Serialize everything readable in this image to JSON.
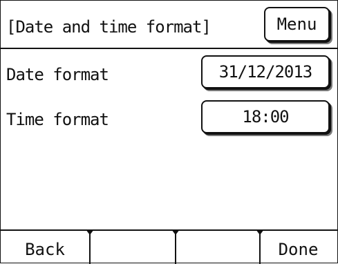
{
  "header": {
    "title": "[Date and time format]",
    "menu_label": "Menu"
  },
  "settings": [
    {
      "label": "Date format",
      "value": "31/12/2013"
    },
    {
      "label": "Time format",
      "value": "18:00"
    }
  ],
  "footer": {
    "keys": [
      {
        "label": "Back"
      },
      {
        "label": ""
      },
      {
        "label": ""
      },
      {
        "label": "Done"
      }
    ]
  },
  "colors": {
    "background": "#ffffff",
    "foreground": "#111111",
    "shadow": "#7a7a7a"
  }
}
